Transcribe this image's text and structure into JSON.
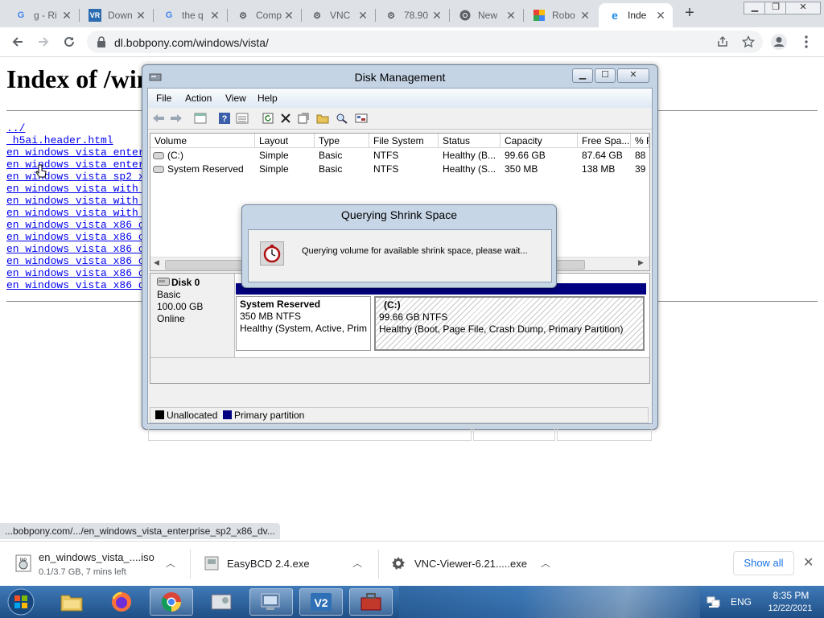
{
  "browser": {
    "tabs": [
      {
        "favicon": "google-icon",
        "title": "g - Ri"
      },
      {
        "favicon": "vr-icon",
        "title": "Down"
      },
      {
        "favicon": "google-icon",
        "title": "the q"
      },
      {
        "favicon": "gear-icon",
        "title": "Comp"
      },
      {
        "favicon": "gear-icon",
        "title": "VNC"
      },
      {
        "favicon": "gear-icon",
        "title": "78.90"
      },
      {
        "favicon": "chrome-icon",
        "title": "New"
      },
      {
        "favicon": "colorful-icon",
        "title": "Robo"
      },
      {
        "favicon": "ie-icon",
        "title": "Inde",
        "active": true
      }
    ],
    "url": "dl.bobpony.com/windows/vista/",
    "new_tab": "+"
  },
  "page": {
    "title": "Index of /windows/vista",
    "links": [
      "../",
      "_h5ai.header.html",
      "en_windows_vista_enterprise",
      "en_windows_vista_enterprise",
      "en_windows_vista_sp2_x64",
      "en_windows_vista_with_sp",
      "en_windows_vista_with_sp",
      "en_windows_vista_with_sp",
      "en_windows_vista_x86_cd1",
      "en_windows_vista_x86_cd2",
      "en_windows_vista_x86_cd3",
      "en_windows_vista_x86_cd4",
      "en_windows_vista_x86_cd5",
      "en_windows_vista_x86_dvd"
    ]
  },
  "disk_mgmt": {
    "title": "Disk Management",
    "menu": [
      "File",
      "Action",
      "View",
      "Help"
    ],
    "columns": [
      "Volume",
      "Layout",
      "Type",
      "File System",
      "Status",
      "Capacity",
      "Free Spa...",
      "% F"
    ],
    "rows": [
      [
        "(C:)",
        "Simple",
        "Basic",
        "NTFS",
        "Healthy (B...",
        "99.66 GB",
        "87.64 GB",
        "88"
      ],
      [
        "System Reserved",
        "Simple",
        "Basic",
        "NTFS",
        "Healthy (S...",
        "350 MB",
        "138 MB",
        "39"
      ]
    ],
    "disk": {
      "name": "Disk 0",
      "type": "Basic",
      "size": "100.00 GB",
      "state": "Online"
    },
    "partitions": [
      {
        "name": "System Reserved",
        "size": "350 MB NTFS",
        "status": "Healthy (System, Active, Prim"
      },
      {
        "name": "(C:)",
        "size": "99.66 GB NTFS",
        "status": "Healthy (Boot, Page File, Crash Dump, Primary Partition)"
      }
    ],
    "legend": [
      "Unallocated",
      "Primary partition"
    ],
    "colors": {
      "unallocated": "#000000",
      "primary": "#000080"
    }
  },
  "dialog": {
    "title": "Querying Shrink Space",
    "message": "Querying volume for available shrink space, please wait..."
  },
  "status_bubble": "...bobpony.com/.../en_windows_vista_enterprise_sp2_x86_dv...",
  "downloads": {
    "items": [
      {
        "name": "en_windows_vista_....iso",
        "progress": "0.1/3.7 GB, 7 mins left"
      },
      {
        "name": "EasyBCD 2.4.exe"
      },
      {
        "name": "VNC-Viewer-6.21.....exe"
      }
    ],
    "show_all": "Show all"
  },
  "taskbar": {
    "lang": "ENG",
    "time": "8:35 PM",
    "date": "12/22/2021"
  }
}
